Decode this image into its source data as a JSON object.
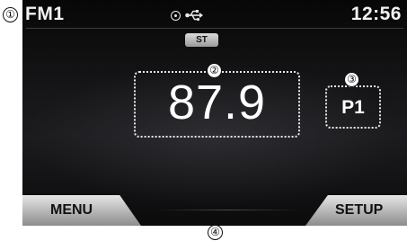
{
  "callouts": [
    "①",
    "②",
    "③",
    "④"
  ],
  "status_bar": {
    "band": "FM1",
    "time": "12:56",
    "icons": [
      "disc-icon",
      "usb-icon"
    ]
  },
  "stereo_indicator": "ST",
  "frequency": "87.9",
  "preset": "P1",
  "softkeys": {
    "menu": "MENU",
    "setup": "SETUP"
  },
  "colors": {
    "screen_background": "#141416",
    "text": "#ffffff",
    "softkey": "#b4b4b4"
  }
}
